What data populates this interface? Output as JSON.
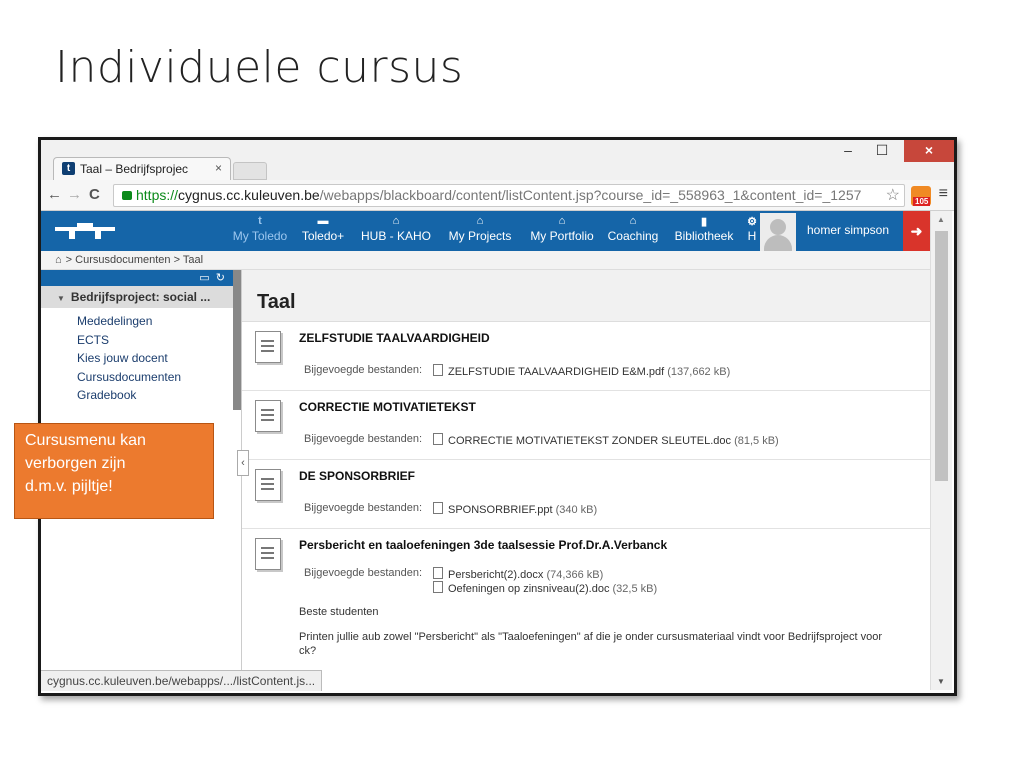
{
  "slide": {
    "title": "Individuele cursus"
  },
  "browser": {
    "tab_title": "Taal – Bedrijfsprojec",
    "tab_close": "×",
    "window": {
      "minimize": "–",
      "maximize": "☐",
      "close": "×"
    },
    "url": {
      "scheme": "https://",
      "host": "cygnus.cc.kuleuven.be",
      "path": "/webapps/blackboard/content/listContent.jsp?course_id=_558963_1&content_id=_1257"
    },
    "rss_badge": "105",
    "status": "cygnus.cc.kuleuven.be/webapps/.../listContent.js..."
  },
  "topnav": {
    "items": [
      {
        "icon": "t",
        "label": "My Toledo",
        "active": true
      },
      {
        "icon": "folder-icon",
        "label": "Toledo+"
      },
      {
        "icon": "building-icon",
        "label": "HUB - KAHO"
      },
      {
        "icon": "building-icon",
        "label": "My Projects"
      },
      {
        "icon": "building-icon",
        "label": "My Portfolio"
      },
      {
        "icon": "building-icon",
        "label": "Coaching"
      },
      {
        "icon": "book-icon",
        "label": "Bibliotheek"
      },
      {
        "icon": "help-icon",
        "label": "H"
      }
    ],
    "user": "homer simpson"
  },
  "breadcrumb": "> Cursusdocumenten > Taal",
  "sidebar": {
    "course": "Bedrijfsproject: social ...",
    "items": [
      "Mededelingen",
      "ECTS",
      "Kies jouw docent",
      "Cursusdocumenten",
      "Gradebook"
    ]
  },
  "content": {
    "title": "Taal",
    "attach_label": "Bijgevoegde bestanden:",
    "items": [
      {
        "title": "ZELFSTUDIE TAALVAARDIGHEID",
        "files": [
          {
            "name": "ZELFSTUDIE TAALVAARDIGHEID E&M.pdf",
            "size": "(137,662 kB)"
          }
        ]
      },
      {
        "title": "CORRECTIE MOTIVATIETEKST",
        "files": [
          {
            "name": "CORRECTIE MOTIVATIETEKST ZONDER SLEUTEL.doc",
            "size": "(81,5 kB)"
          }
        ]
      },
      {
        "title": "DE SPONSORBRIEF",
        "files": [
          {
            "name": "SPONSORBRIEF.ppt",
            "size": "(340 kB)"
          }
        ]
      },
      {
        "title": "Persbericht en taaloefeningen 3de taalsessie Prof.Dr.A.Verbanck",
        "files": [
          {
            "name": "Persbericht(2).docx",
            "size": "(74,366 kB)"
          },
          {
            "name": "Oefeningen op zinsniveau(2).doc",
            "size": "(32,5 kB)"
          }
        ],
        "body": [
          "Beste studenten",
          "Printen jullie aub zowel \"Persbericht\" als \"Taaloefeningen\" af die je onder cursusmateriaal vindt voor Bedrijfsproject voor",
          "ck?"
        ]
      }
    ]
  },
  "callout": {
    "lines": [
      "Cursusmenu kan",
      "verborgen zijn",
      "d.m.v. pijltje!"
    ]
  }
}
